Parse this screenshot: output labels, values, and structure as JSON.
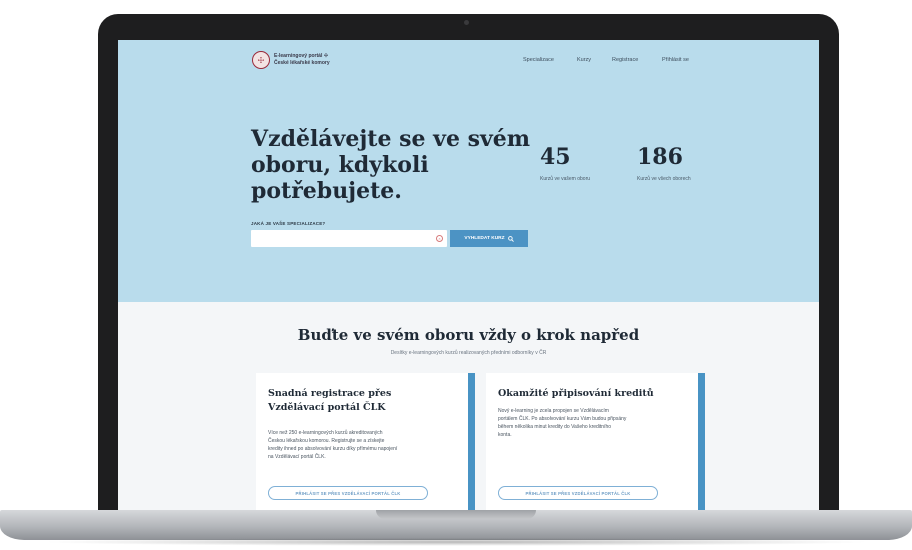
{
  "header": {
    "logo_symbol": "☩",
    "logo_line1": "E-learningový portál ☩",
    "logo_line2": "České lékařské komory",
    "nav": [
      "Specializace",
      "Kurzy",
      "Registrace",
      "Přihlásit se"
    ]
  },
  "hero": {
    "title_lines": [
      "Vzdělávejte se ve svém",
      "oboru, kdykoli",
      "potřebujete."
    ],
    "specialization_label": "JAKÁ JE VAŠE SPECIALIZACE?",
    "search_value": "",
    "search_button": "VYHLEDAT KURZ",
    "stats": [
      {
        "number": "45",
        "desc": "Kurzů ve vašem oboru"
      },
      {
        "number": "186",
        "desc": "Kurzů ve všech oborech"
      }
    ]
  },
  "section": {
    "title": "Buďte ve svém oboru vždy o krok napřed",
    "subtitle": "Desítky e-learningových kurzů realizovaných předními odborníky v ČR"
  },
  "cards": [
    {
      "title_lines": [
        "Snadná registrace přes",
        "Vzdělávací portál ČLK"
      ],
      "text_lines": [
        "Více než 250 e-learningových kurzů akreditovaných",
        "Českou lékařskou komorou. Registrujte se a získejte",
        "kredity ihned po absolvování kurzu díky přímému napojení",
        "na Vzdělávací portál ČLK."
      ],
      "button": "PŘIHLÁSIT SE PŘES VZDĚLÁVACÍ PORTÁL ČLK"
    },
    {
      "title_lines": [
        "Okamžité připisování kreditů"
      ],
      "text_lines": [
        "Nový e-learning je zcela propojen se Vzdělávacím",
        "portálem ČLK. Po absolvování kurzu Vám budou připsány",
        "během několika minut kredity do Vašeho kreditního",
        "konta."
      ],
      "button": "PŘIHLÁSIT SE PŘES VZDĚLÁVACÍ PORTÁL ČLK"
    }
  ],
  "icons": {
    "clear": "×"
  }
}
